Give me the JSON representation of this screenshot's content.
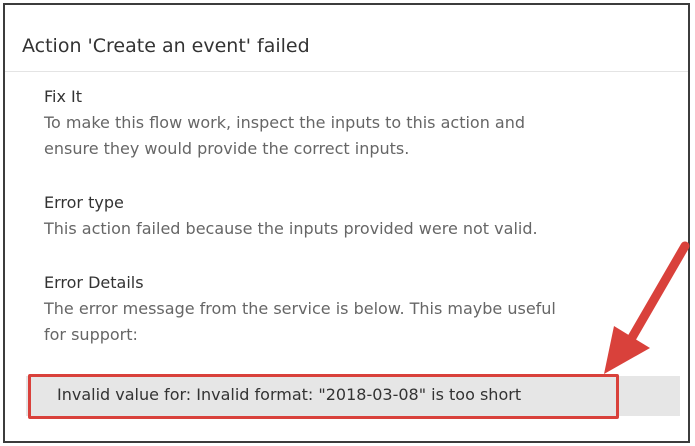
{
  "dialog": {
    "title": "Action 'Create an event' failed"
  },
  "sections": [
    {
      "title": "Fix It",
      "body_lines": [
        "To make this flow work, inspect the inputs to this action and",
        "ensure they would provide the correct inputs."
      ]
    },
    {
      "title": "Error type",
      "body_lines": [
        "This action failed because the inputs provided were not valid."
      ]
    },
    {
      "title": "Error Details",
      "body_lines": [
        "The error message from the service is below. This maybe useful",
        "for support:"
      ]
    }
  ],
  "error_message": "Invalid value for: Invalid format: \"2018-03-08\" is too short",
  "colors": {
    "highlight": "#d9413b",
    "message_background": "#e6e6e6"
  },
  "icons": {
    "callout_arrow": "red-pointer-arrow-icon"
  }
}
